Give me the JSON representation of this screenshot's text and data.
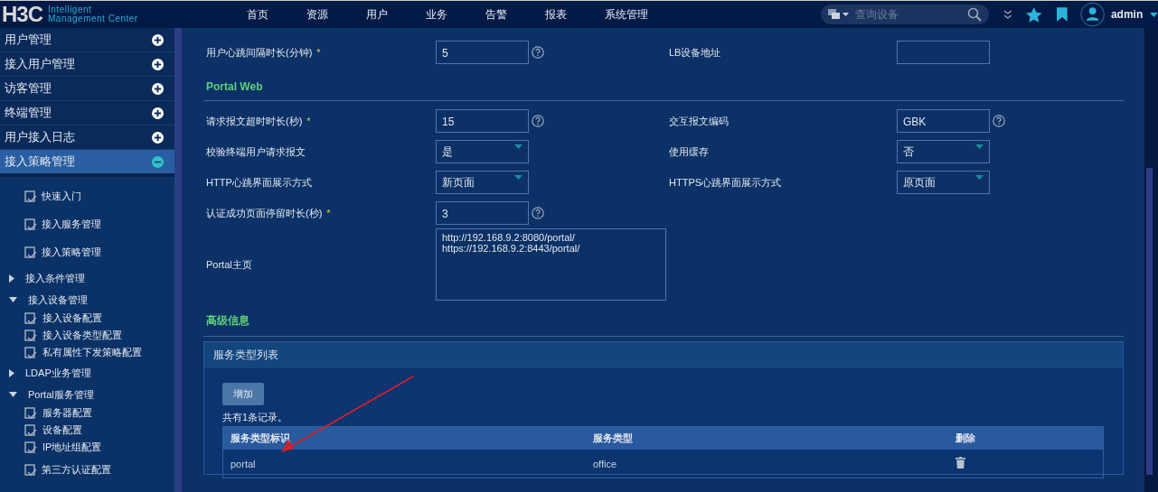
{
  "header": {
    "logo": {
      "mark": "H3C",
      "line1": "Intelligent",
      "line2": "Management Center"
    },
    "nav": [
      "首页",
      "资源",
      "用户",
      "业务",
      "告警",
      "报表",
      "系统管理"
    ],
    "search": {
      "placeholder": "查询设备"
    },
    "user": "admin"
  },
  "sidebar": {
    "menus": [
      {
        "label": "用户管理",
        "expanded": false
      },
      {
        "label": "接入用户管理",
        "expanded": false
      },
      {
        "label": "访客管理",
        "expanded": false
      },
      {
        "label": "终端管理",
        "expanded": false
      },
      {
        "label": "用户接入日志",
        "expanded": false
      },
      {
        "label": "接入策略管理",
        "expanded": true,
        "children": [
          {
            "kind": "link",
            "label": "快速入门"
          },
          {
            "kind": "link",
            "label": "接入服务管理"
          },
          {
            "kind": "link",
            "label": "接入策略管理"
          },
          {
            "kind": "group",
            "label": "接入条件管理",
            "expanded": false
          },
          {
            "kind": "group",
            "label": "接入设备管理",
            "expanded": true,
            "children": [
              {
                "label": "接入设备配置"
              },
              {
                "label": "接入设备类型配置"
              },
              {
                "label": "私有属性下发策略配置"
              }
            ]
          },
          {
            "kind": "group",
            "label": "LDAP业务管理",
            "expanded": false
          },
          {
            "kind": "group",
            "label": "Portal服务管理",
            "expanded": true,
            "children": [
              {
                "label": "服务器配置"
              },
              {
                "label": "设备配置"
              },
              {
                "label": "IP地址组配置"
              }
            ]
          },
          {
            "kind": "link",
            "label": "第三方认证配置"
          }
        ]
      }
    ]
  },
  "form": [
    {
      "kind": "row",
      "cells": [
        {
          "label": "用户心跳间隔时长(分钟)",
          "required_mark": "*",
          "kind": "input",
          "value": "5",
          "help": true
        },
        {
          "label": "LB设备地址",
          "kind": "input",
          "help": false
        }
      ]
    },
    {
      "kind": "section",
      "title": "Portal Web"
    },
    {
      "kind": "row",
      "cells": [
        {
          "label": "请求报文超时时长(秒)",
          "required_mark": "*",
          "kind": "input",
          "value": "15",
          "help": true
        },
        {
          "label": "交互报文编码",
          "kind": "input",
          "value": "GBK",
          "help": true
        }
      ]
    },
    {
      "kind": "row",
      "cells": [
        {
          "label": "校验终端用户请求报文",
          "kind": "select",
          "value": "是",
          "help": false
        },
        {
          "label": "使用缓存",
          "kind": "select",
          "value": "否",
          "help": false
        }
      ]
    },
    {
      "kind": "row",
      "cells": [
        {
          "label": "HTTP心跳界面展示方式",
          "kind": "select",
          "value": "新页面",
          "help": false
        },
        {
          "label": "HTTPS心跳界面展示方式",
          "kind": "select",
          "value": "原页面",
          "help": false
        }
      ]
    },
    {
      "kind": "row",
      "cells": [
        {
          "label": "认证成功页面停留时长(秒)",
          "required_mark": "*",
          "kind": "input",
          "value": "3",
          "help": true
        }
      ]
    },
    {
      "kind": "row",
      "cells": [
        {
          "label": "Portal主页",
          "kind": "textarea",
          "value": "http://192.168.9.2:8080/portal/\nhttps://192.168.9.2:8443/portal/",
          "help": false
        }
      ]
    },
    {
      "kind": "section",
      "title": "高级信息"
    }
  ],
  "service_panel": {
    "title": "服务类型列表",
    "add_button": "增加",
    "count": "共有1条记录。",
    "columns": [
      "服务类型标识",
      "服务类型",
      "删除"
    ],
    "rows": [
      {
        "id": "portal",
        "type": "office"
      }
    ]
  }
}
